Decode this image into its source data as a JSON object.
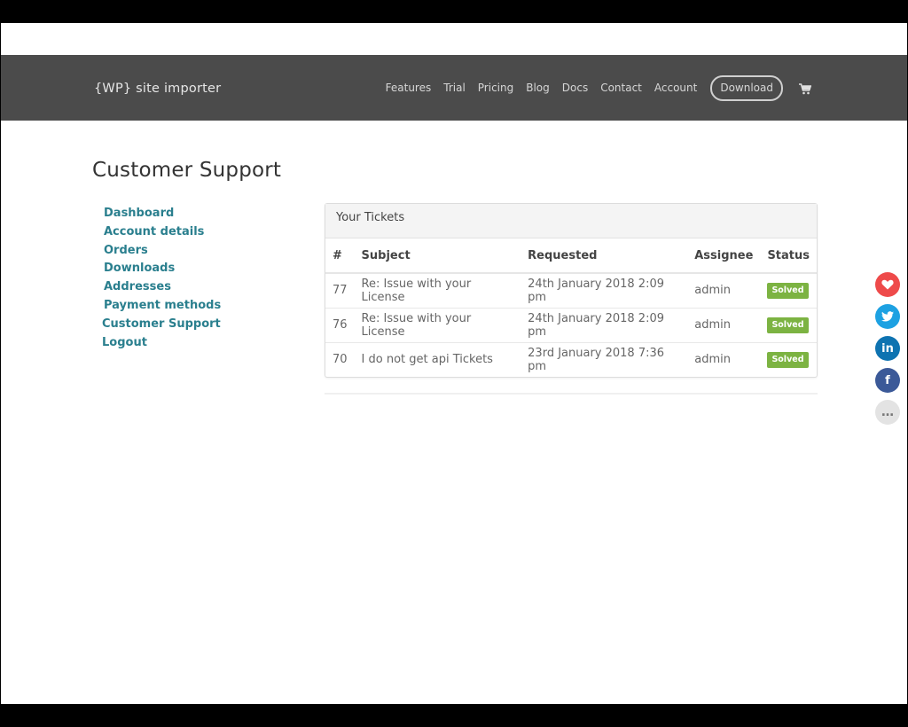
{
  "header": {
    "logo": "{WP} site importer",
    "nav": [
      "Features",
      "Trial",
      "Pricing",
      "Blog",
      "Docs",
      "Contact",
      "Account"
    ],
    "download_label": "Download",
    "cart_icon": "shopping-cart-icon"
  },
  "page": {
    "title": "Customer Support"
  },
  "sidebar": {
    "items": [
      "Dashboard",
      "Account details",
      "Orders",
      "Downloads",
      "Addresses",
      "Payment methods",
      "Customer Support",
      "Logout"
    ]
  },
  "tickets": {
    "panel_title": "Your Tickets",
    "columns": [
      "#",
      "Subject",
      "Requested",
      "Assignee",
      "Status"
    ],
    "rows": [
      {
        "id": "77",
        "subject": "Re: Issue with your License",
        "requested": "24th January 2018 2:09 pm",
        "assignee": "admin",
        "status": "Solved"
      },
      {
        "id": "76",
        "subject": "Re: Issue with your License",
        "requested": "24th January 2018 2:09 pm",
        "assignee": "admin",
        "status": "Solved"
      },
      {
        "id": "70",
        "subject": "I do not get api Tickets",
        "requested": "23rd January 2018 7:36 pm",
        "assignee": "admin",
        "status": "Solved"
      }
    ],
    "status_color": "#7cb342"
  },
  "share": {
    "buttons": [
      {
        "icon": "heart-icon",
        "glyph": "♥",
        "color": "#ee4a4a"
      },
      {
        "icon": "twitter-icon",
        "glyph": "🐦",
        "color": "#1da1e2"
      },
      {
        "icon": "linkedin-icon",
        "glyph": "in",
        "color": "#0e73b1"
      },
      {
        "icon": "facebook-icon",
        "glyph": "f",
        "color": "#3b5998"
      },
      {
        "icon": "more-icon",
        "glyph": "…",
        "color": "#e3e3e3"
      }
    ]
  }
}
